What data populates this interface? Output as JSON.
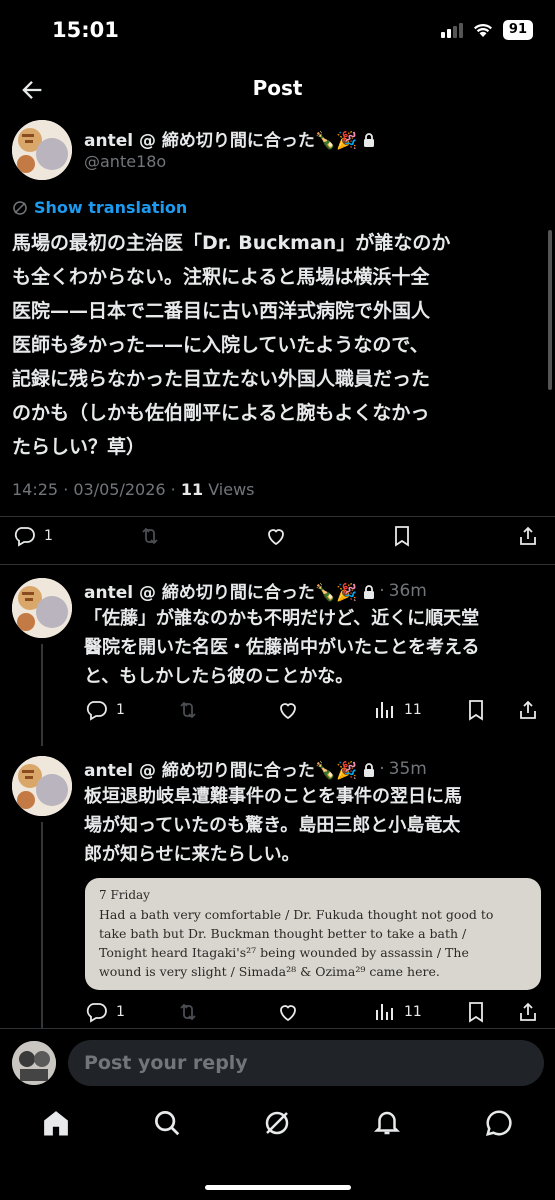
{
  "status": {
    "time": "15:01",
    "battery": "91"
  },
  "header": {
    "title": "Post"
  },
  "post": {
    "author_name": "antel @ 締め切り間に合った🍾🎉",
    "handle": "@ante18o",
    "translate_label": "Show translation",
    "lines": [
      "馬場の最初の主治医「Dr. Buckman」が誰なのか",
      "も全くわからない。注釈によると馬場は横浜十全",
      "医院——日本で二番目に古い西洋式病院で外国人",
      "医師も多かった——に入院していたようなので、",
      "記録に残らなかった目立たない外国人職員だった",
      "のかも（しかも佐伯剛平によると腕もよくなかっ",
      "たらしい？草）"
    ],
    "timestamp": "14:25 · 03/05/2026 · ",
    "views_count": "11",
    "views_label": " Views",
    "replies": "1"
  },
  "replies": [
    {
      "author_name": "antel @ 締め切り間に合った🍾🎉",
      "time": "36m",
      "lines": [
        "「佐藤」が誰なのかも不明だけど、近くに順天堂",
        "醫院を開いた名医・佐藤尚中がいたことを考える",
        "と、もしかしたら彼のことかな。"
      ],
      "reply_count": "1",
      "views": "11"
    },
    {
      "author_name": "antel @ 締め切り間に合った🍾🎉",
      "time": "35m",
      "lines": [
        "板垣退助岐阜遭難事件のことを事件の翌日に馬",
        "場が知っていたのも驚き。島田三郎と小島竜太",
        "郎が知らせに来たらしい。"
      ],
      "image": {
        "day": "7 Friday",
        "lines": [
          "Had a bath very comfortable / Dr. Fukuda thought not good to",
          "take bath but Dr. Buckman thought better to take a bath /",
          "Tonight heard Itagaki's²⁷ being wounded by assassin / The",
          "wound is very slight / Simada²⁸ & Ozima²⁹ came here."
        ]
      },
      "reply_count": "1",
      "views": "11"
    }
  ],
  "composer": {
    "placeholder": "Post your reply"
  },
  "colors": {
    "accent": "#1d9bf0",
    "muted": "#71767b",
    "background": "#000000"
  }
}
